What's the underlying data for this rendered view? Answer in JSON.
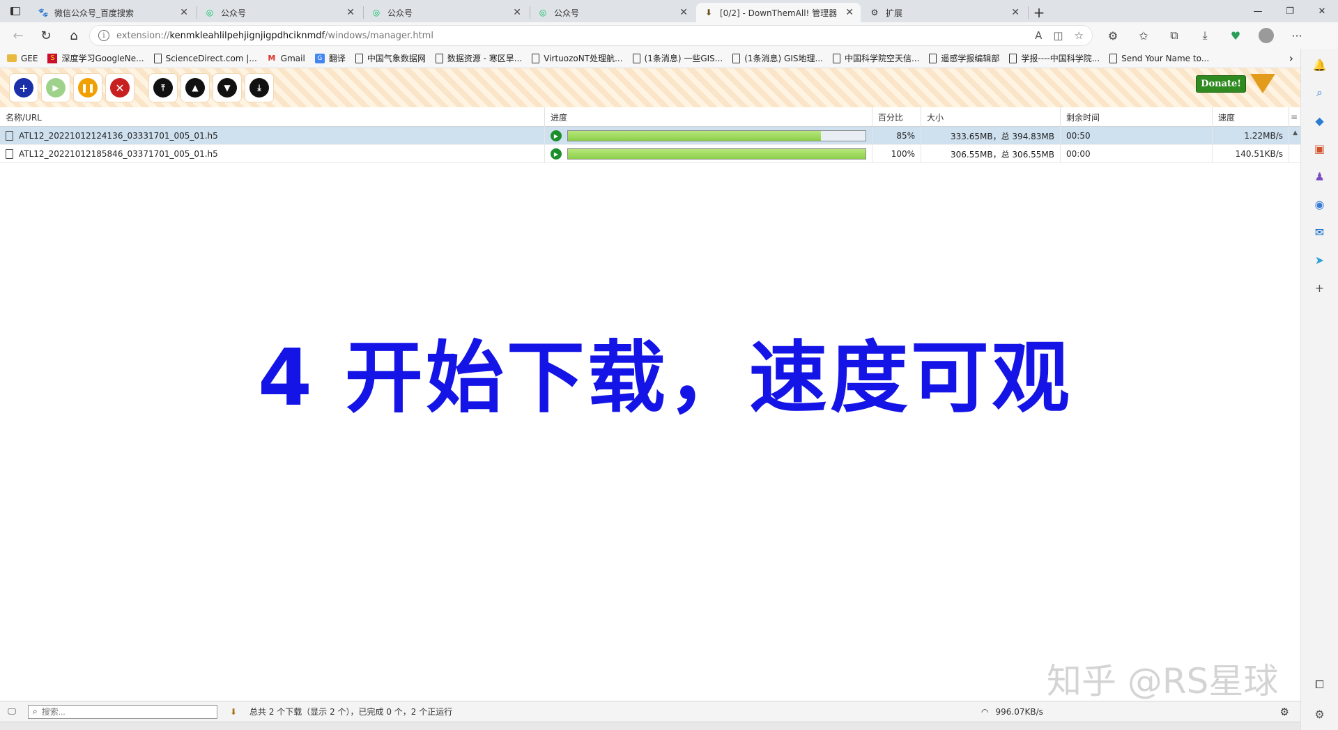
{
  "browser": {
    "tabs": [
      {
        "title": "微信公众号_百度搜索",
        "favicon": "paw-icon",
        "active": false
      },
      {
        "title": "公众号",
        "favicon": "wechat-icon",
        "active": false
      },
      {
        "title": "公众号",
        "favicon": "wechat-icon",
        "active": false
      },
      {
        "title": "公众号",
        "favicon": "wechat-icon",
        "active": false
      },
      {
        "title": "[0/2] - DownThemAll! 管理器",
        "favicon": "dta-icon",
        "active": true
      },
      {
        "title": "扩展",
        "favicon": "puzzle-icon",
        "active": false
      }
    ],
    "url_prefix": "extension://",
    "url_host": "kenmkleahlilpehjignjigpdhciknmdf",
    "url_path": "/windows/manager.html",
    "bookmarks": [
      {
        "label": "GEE",
        "icon": "folder"
      },
      {
        "label": "深度学习GoogleNe...",
        "icon": "page"
      },
      {
        "label": "ScienceDirect.com |...",
        "icon": "page"
      },
      {
        "label": "Gmail",
        "icon": "gmail"
      },
      {
        "label": "翻译",
        "icon": "translate"
      },
      {
        "label": "中国气象数据网",
        "icon": "page"
      },
      {
        "label": "数据资源 - 寒区旱...",
        "icon": "page"
      },
      {
        "label": "VirtuozoNT处理航...",
        "icon": "page"
      },
      {
        "label": "(1条消息) 一些GIS...",
        "icon": "page"
      },
      {
        "label": "(1条消息) GIS地理...",
        "icon": "page"
      },
      {
        "label": "中国科学院空天信...",
        "icon": "page"
      },
      {
        "label": "遥感学报编辑部",
        "icon": "page"
      },
      {
        "label": "学报----中国科学院...",
        "icon": "page"
      },
      {
        "label": "Send Your Name to...",
        "icon": "page"
      }
    ]
  },
  "manager": {
    "donate_label": "Donate!",
    "columns": {
      "name": "名称/URL",
      "progress": "进度",
      "percent": "百分比",
      "size": "大小",
      "remaining": "剩余时间",
      "speed": "速度"
    },
    "downloads": [
      {
        "name": "ATL12_20221012124136_03331701_005_01.h5",
        "progress": 0.85,
        "percent": "85%",
        "size": "333.65MB，总 394.83MB",
        "remaining": "00:50",
        "speed": "1.22MB/s",
        "selected": true
      },
      {
        "name": "ATL12_20221012185846_03371701_005_01.h5",
        "progress": 1.0,
        "percent": "100%",
        "size": "306.55MB，总 306.55MB",
        "remaining": "00:00",
        "speed": "140.51KB/s",
        "selected": false
      }
    ],
    "search_placeholder": "搜索...",
    "status_summary": "总共 2 个下载（显示 2 个），已完成 0 个，2 个正运行",
    "total_speed": "996.07KB/s"
  },
  "overlay": {
    "caption": "4 开始下载，速度可观",
    "watermark": "知乎 @RS星球"
  },
  "colors": {
    "caption": "#1414e6",
    "progress_fill": "#8ccf4b",
    "selected_row": "#cfe0ef",
    "donate": "#2f8a1f"
  }
}
